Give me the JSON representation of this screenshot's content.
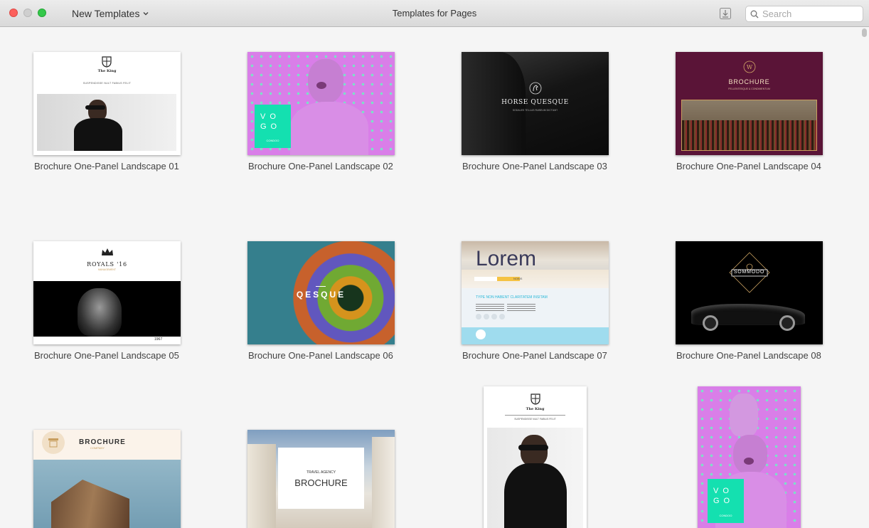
{
  "toolbar": {
    "menu_label": "New Templates",
    "window_title": "Templates for Pages",
    "search_placeholder": "Search"
  },
  "templates": [
    {
      "name": "Brochure One-Panel Landscape 01",
      "thumb_text": [
        "The King",
        "SUSPENDISSE NULT FABIUS FELIT"
      ]
    },
    {
      "name": "Brochure One-Panel Landscape 02",
      "thumb_text": [
        "CONDOO"
      ]
    },
    {
      "name": "Brochure One-Panel Landscape 03",
      "thumb_text": [
        "HORSE QUESQUE",
        "SODALES TELLUS RUBEUM DICTUM?"
      ]
    },
    {
      "name": "Brochure One-Panel Landscape 04",
      "thumb_text": [
        "BROCHURE",
        "PELLENTESQUE & CONDIMENTUM"
      ]
    },
    {
      "name": "Brochure One-Panel Landscape 05",
      "thumb_text": [
        "ROYALS '16",
        "MANAGEMENT",
        "1967"
      ]
    },
    {
      "name": "Brochure One-Panel Landscape 06",
      "thumb_text": [
        "QESQUE"
      ]
    },
    {
      "name": "Brochure One-Panel Landscape 07",
      "thumb_text": [
        "Lorem",
        "TYPE NON HABENT CLARITATEM INSITAM",
        "NOBIS"
      ]
    },
    {
      "name": "Brochure One-Panel Landscape 08",
      "thumb_text": [
        "SOMMODO"
      ]
    },
    {
      "name": "",
      "thumb_text": [
        "BROCHURE",
        "COMPANY"
      ]
    },
    {
      "name": "",
      "thumb_text": [
        "TRAVEL AGENCY",
        "BROCHURE"
      ]
    },
    {
      "name": "",
      "thumb_text": [
        "The King",
        "SUSPENDISSE NULT FABIUS FELIT"
      ]
    },
    {
      "name": "",
      "thumb_text": [
        "CONDOO"
      ]
    }
  ]
}
